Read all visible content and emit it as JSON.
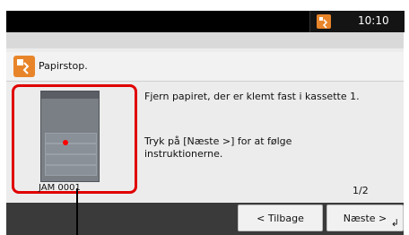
{
  "header": {
    "time": "10:10"
  },
  "alert": {
    "title": "Papirstop."
  },
  "printer": {
    "label": "JAM 0001"
  },
  "instructions": {
    "line1": "Fjern papiret, der er klemt fast i kassette 1.",
    "line2": "Tryk på [Næste >] for at følge instruktionerne."
  },
  "pagination": {
    "text": "1/2"
  },
  "footer": {
    "back_label": "< Tilbage",
    "next_label": "Næste >"
  },
  "colors": {
    "alert": "#e8852a",
    "highlight": "#e00000"
  },
  "icons": {
    "status": "error-icon",
    "alert": "paper-jam-icon",
    "enter": "enter-icon"
  }
}
